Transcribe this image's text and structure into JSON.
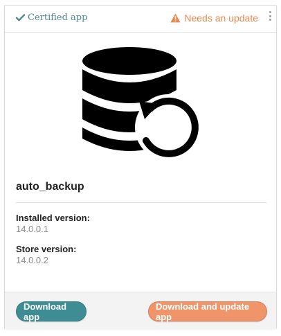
{
  "header": {
    "certified_label": "Certified app",
    "certified_icon": "check-icon",
    "status_label": "Needs an update",
    "status_icon": "warning-triangle-icon",
    "menu_icon": "kebab-menu-icon"
  },
  "app": {
    "icon": "database-restore-icon",
    "name": "auto_backup"
  },
  "versions": {
    "installed_label": "Installed version:",
    "installed_value": "14.0.0.1",
    "store_label": "Store version:",
    "store_value": "14.0.0.2"
  },
  "footer": {
    "download_label": "Download app",
    "update_label": "Download and update app"
  },
  "colors": {
    "certified": "#4a8a90",
    "warning": "#e8894f",
    "primary_button": "#3f8d94",
    "secondary_button": "#f0946a"
  }
}
